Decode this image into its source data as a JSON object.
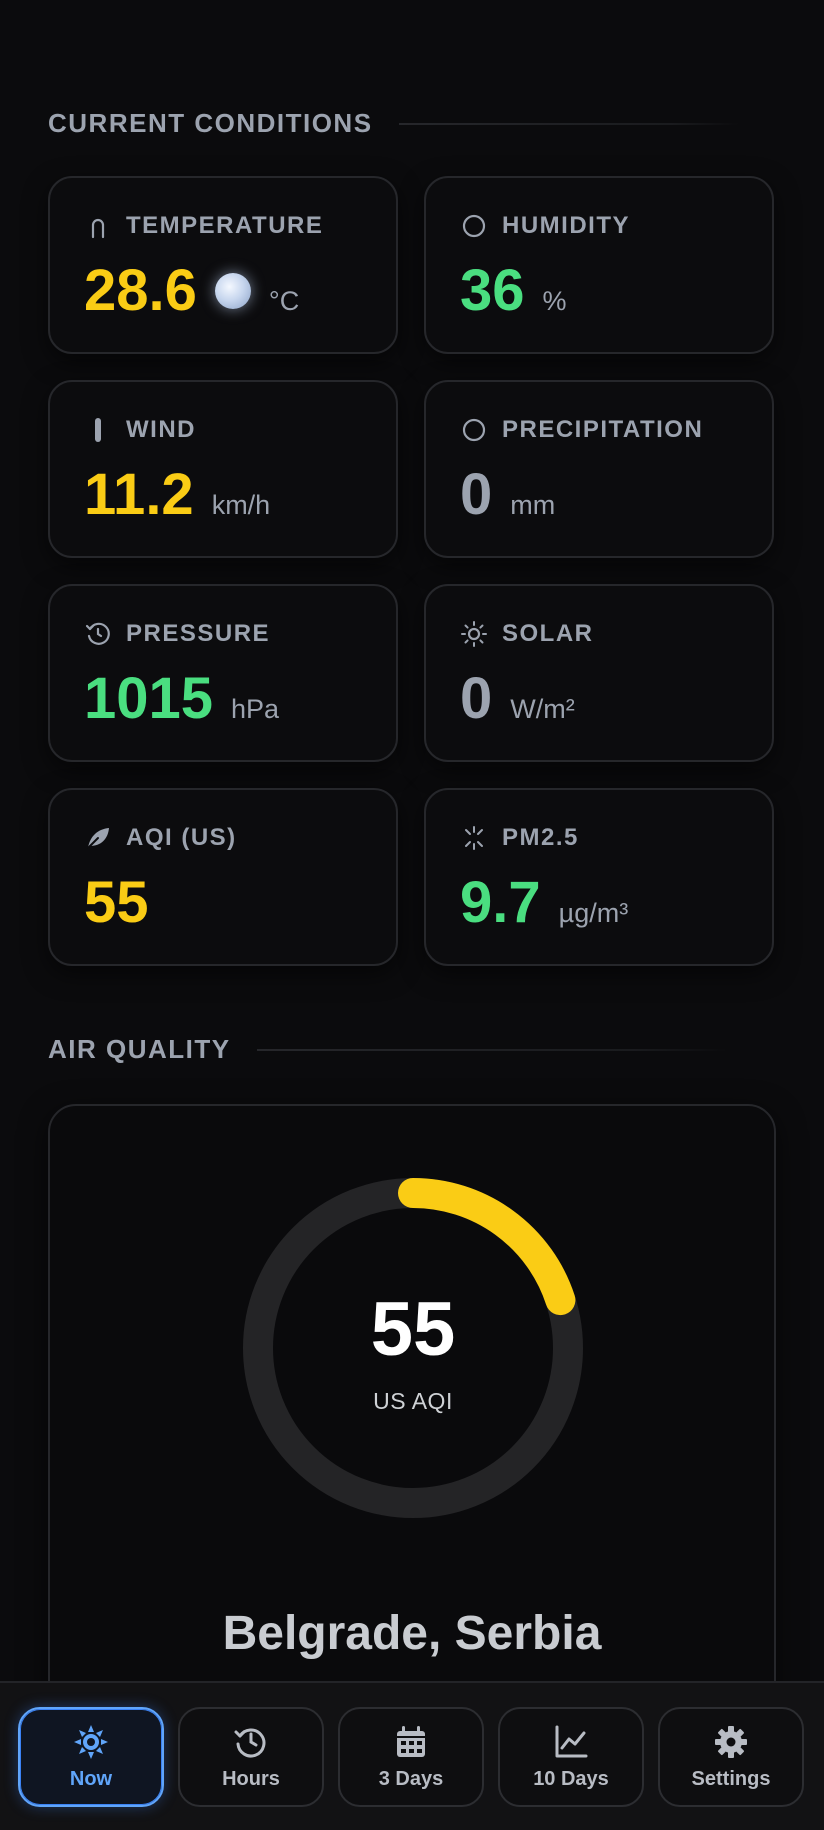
{
  "sections": {
    "current_conditions": "CURRENT CONDITIONS",
    "air_quality": "AIR QUALITY"
  },
  "cards": [
    {
      "label": "TEMPERATURE",
      "value": "28.6",
      "unit": "°C",
      "icon": "thermometer-icon",
      "color": "#facc15"
    },
    {
      "label": "HUMIDITY",
      "value": "36",
      "unit": "%",
      "icon": "circle-icon",
      "color": "#4ade80"
    },
    {
      "label": "WIND",
      "value": "11.2",
      "unit": "km/h",
      "icon": "wind-bar-icon",
      "color": "#facc15"
    },
    {
      "label": "PRECIPITATION",
      "value": "0",
      "unit": "mm",
      "icon": "circle-icon",
      "color": "#9ca3af"
    },
    {
      "label": "PRESSURE",
      "value": "1015",
      "unit": "hPa",
      "icon": "pressure-gauge-icon",
      "color": "#4ade80"
    },
    {
      "label": "SOLAR",
      "value": "0",
      "unit": "W/m²",
      "icon": "sun-icon",
      "color": "#9ca3af"
    },
    {
      "label": "AQI (US)",
      "value": "55",
      "unit": "",
      "icon": "leaf-icon",
      "color": "#facc15"
    },
    {
      "label": "PM2.5",
      "value": "9.7",
      "unit": "µg/m³",
      "icon": "particles-icon",
      "color": "#4ade80"
    }
  ],
  "moon_phase_icon": "moon-icon",
  "air_quality": {
    "aqi_value": "55",
    "aqi_caption": "US AQI",
    "aqi_gauge_fraction": 0.2,
    "gauge_color": "#facc15",
    "location": "Belgrade, Serbia"
  },
  "nav": [
    {
      "label": "Now",
      "icon": "sun-gear-icon",
      "active": true
    },
    {
      "label": "Hours",
      "icon": "history-clock-icon",
      "active": false
    },
    {
      "label": "3 Days",
      "icon": "calendar-icon",
      "active": false
    },
    {
      "label": "10 Days",
      "icon": "line-chart-icon",
      "active": false
    },
    {
      "label": "Settings",
      "icon": "gear-icon",
      "active": false
    }
  ]
}
